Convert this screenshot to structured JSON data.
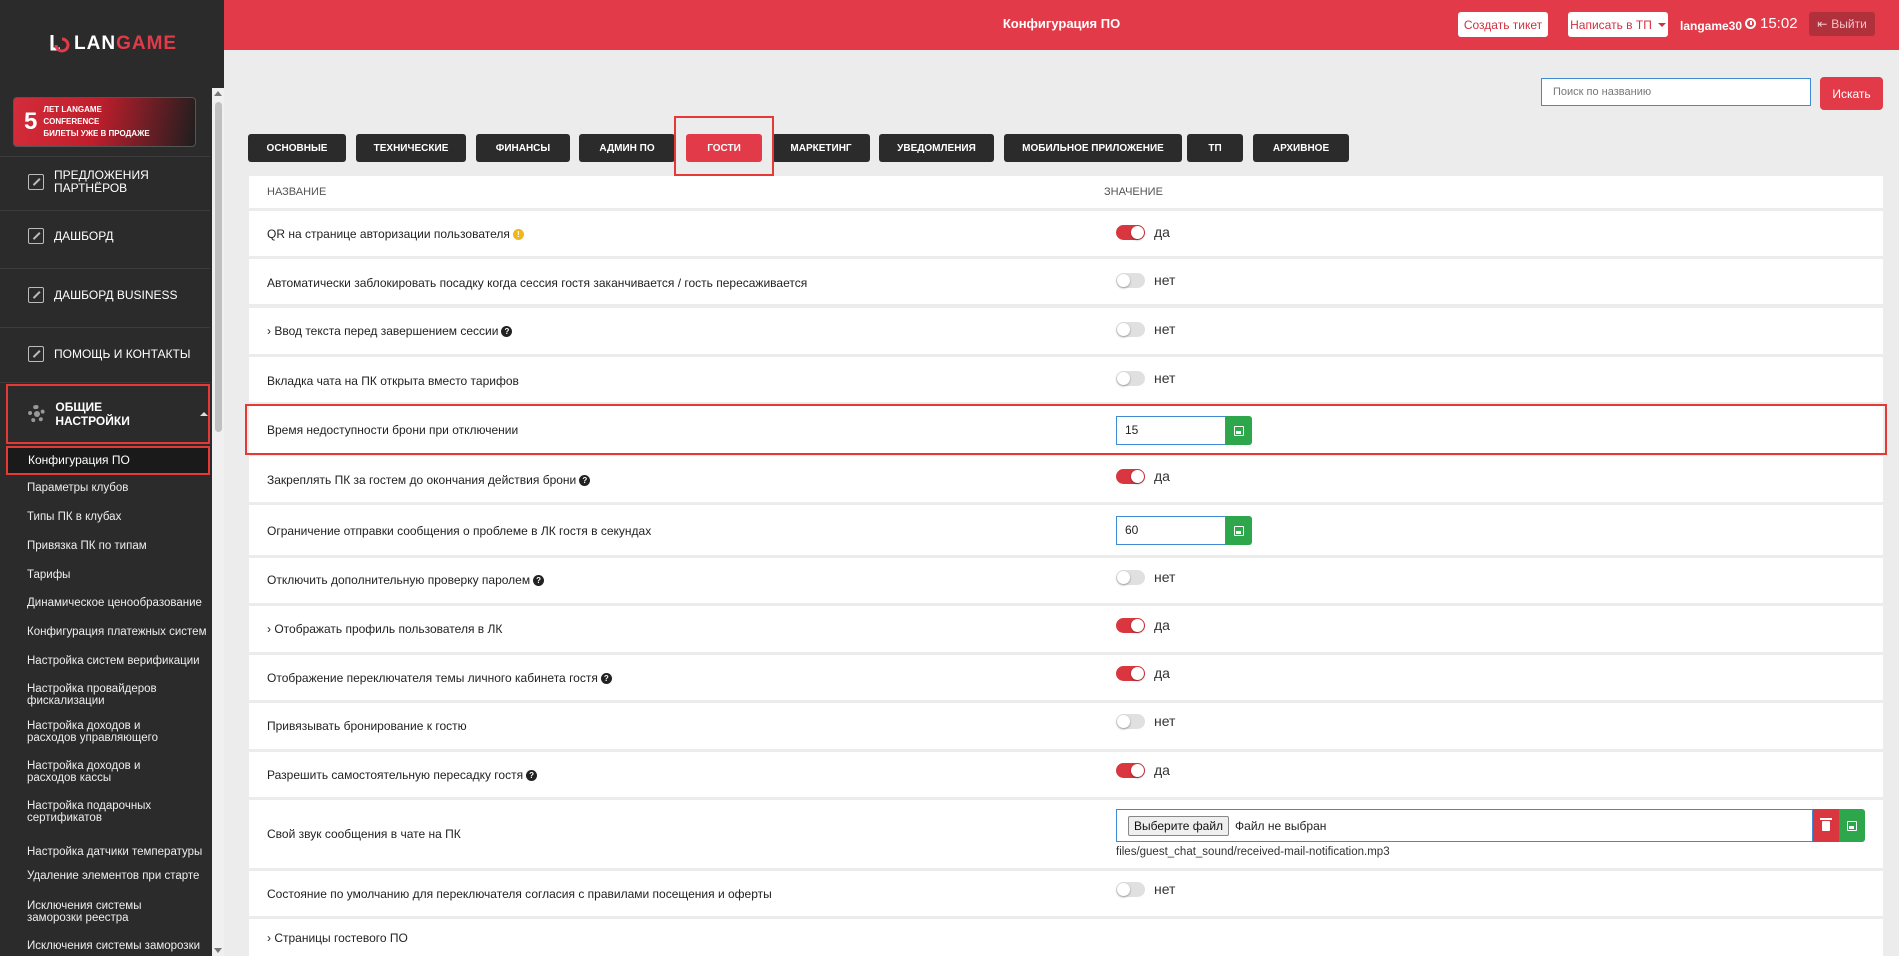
{
  "brand": {
    "logo_a": "LAN",
    "logo_b": "GAME",
    "accent": "#e23a48"
  },
  "banner": {
    "num": "5",
    "line1": "лет LANGAME",
    "line2": "conference",
    "line3": "билеты уже в продаже"
  },
  "sidebar": {
    "nav": [
      {
        "label": "Предложения партнёров",
        "icon": "edit-icon"
      },
      {
        "label": "Дашборд",
        "icon": "document-icon"
      },
      {
        "label": "Дашборд Business",
        "icon": "edit-icon"
      },
      {
        "label": "Помощь и контакты",
        "icon": "edit-icon"
      }
    ],
    "settings_label": "Общие настройки",
    "active_sub": "Конфигурация ПО",
    "subitems": [
      "Параметры клубов",
      "Типы ПК в клубах",
      "Привязка ПК по типам",
      "Тарифы",
      "Динамическое ценообразование",
      "Конфигурация платежных систем",
      "Настройка систем верификации",
      "Настройка провайдеров фискализации",
      "Настройка доходов и расходов управляющего",
      "Настройка доходов и расходов кассы",
      "Настройка подарочных сертификатов",
      "Настройка датчики температуры",
      "Удаление элементов при старте",
      "Исключения системы заморозки реестра",
      "Исключения системы заморозки"
    ]
  },
  "header": {
    "title": "Конфигурация ПО",
    "create_ticket": "Создать тикет",
    "write_support": "Написать в ТП",
    "user": "langame30",
    "time": "15:02",
    "logout": "Выйти"
  },
  "search": {
    "placeholder": "Поиск по названию",
    "button": "Искать"
  },
  "tabs": [
    "Основные",
    "Технические",
    "Финансы",
    "Админ ПО",
    "Гости",
    "Маркетинг",
    "Уведомления",
    "Мобильное приложение",
    "ТП",
    "Архивное"
  ],
  "active_tab": "Гости",
  "table": {
    "col_name": "Название",
    "col_value": "Значение",
    "rows": [
      {
        "name": "QR на странице авторизации пользователя",
        "type": "toggle",
        "on": true,
        "value": "да",
        "icon": "warning"
      },
      {
        "name": "Автоматически заблокировать посадку когда сессия гостя заканчивается / гость пересаживается",
        "type": "toggle",
        "on": false,
        "value": "нет"
      },
      {
        "name": "› Ввод текста перед завершением сессии",
        "type": "toggle",
        "on": false,
        "value": "нет",
        "icon": "question"
      },
      {
        "name": "Вкладка чата на ПК открыта вместо тарифов",
        "type": "toggle",
        "on": false,
        "value": "нет"
      },
      {
        "name": "Время недоступности брони при отключении",
        "type": "number",
        "value": "15"
      },
      {
        "name": "Закреплять ПК за гостем до окончания действия брони",
        "type": "toggle",
        "on": true,
        "value": "да",
        "icon": "question"
      },
      {
        "name": "Ограничение отправки сообщения о проблеме в ЛК гостя в секундах",
        "type": "number",
        "value": "60"
      },
      {
        "name": "Отключить дополнительную проверку паролем",
        "type": "toggle",
        "on": false,
        "value": "нет",
        "icon": "question"
      },
      {
        "name": "› Отображать профиль пользователя в ЛК",
        "type": "toggle",
        "on": true,
        "value": "да"
      },
      {
        "name": "Отображение переключателя темы личного кабинета гостя",
        "type": "toggle",
        "on": true,
        "value": "да",
        "icon": "question"
      },
      {
        "name": "Привязывать бронирование к гостю",
        "type": "toggle",
        "on": false,
        "value": "нет"
      },
      {
        "name": "Разрешить самостоятельную пересадку гостя",
        "type": "toggle",
        "on": true,
        "value": "да",
        "icon": "question"
      },
      {
        "name": "Свой звук сообщения в чате на ПК",
        "type": "file",
        "button": "Выберите файл",
        "status": "Файл не выбран",
        "path": "files/guest_chat_sound/received-mail-notification.mp3"
      },
      {
        "name": "Состояние по умолчанию для переключателя согласия с правилами посещения и оферты",
        "type": "toggle",
        "on": false,
        "value": "нет"
      },
      {
        "name": "› Страницы гостевого ПО",
        "type": "none"
      }
    ]
  }
}
